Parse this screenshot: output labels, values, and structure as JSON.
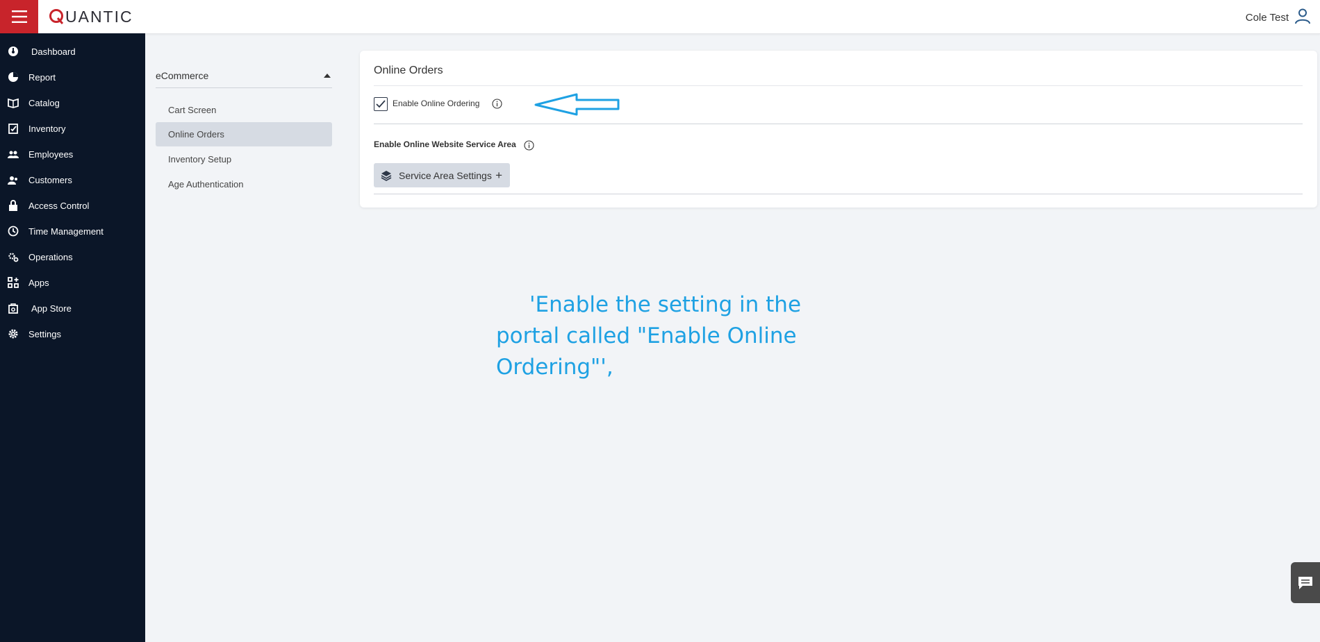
{
  "header": {
    "logo_text": "UANTIC",
    "user_name": "Cole Test"
  },
  "sidebar": {
    "items": [
      {
        "label": "Dashboard",
        "icon": "dashboard-icon"
      },
      {
        "label": "Report",
        "icon": "pie-chart-icon"
      },
      {
        "label": "Catalog",
        "icon": "book-icon"
      },
      {
        "label": "Inventory",
        "icon": "clipboard-check-icon"
      },
      {
        "label": "Employees",
        "icon": "people-icon"
      },
      {
        "label": "Customers",
        "icon": "customers-icon"
      },
      {
        "label": "Access Control",
        "icon": "lock-icon"
      },
      {
        "label": "Time Management",
        "icon": "clock-icon"
      },
      {
        "label": "Operations",
        "icon": "gears-icon"
      },
      {
        "label": "Apps",
        "icon": "apps-icon"
      },
      {
        "label": "App Store",
        "icon": "store-icon"
      },
      {
        "label": "Settings",
        "icon": "gear-icon"
      }
    ]
  },
  "submenu": {
    "title": "eCommerce",
    "items": [
      {
        "label": "Cart Screen",
        "active": false
      },
      {
        "label": "Online Orders",
        "active": true
      },
      {
        "label": "Inventory Setup",
        "active": false
      },
      {
        "label": "Age Authentication",
        "active": false
      }
    ]
  },
  "card": {
    "title": "Online Orders",
    "enable_online_ordering_label": "Enable Online Ordering",
    "enable_online_ordering_checked": true,
    "service_area_label": "Enable Online Website Service Area",
    "service_area_button": "Service Area Settings",
    "plus_symbol": "+"
  },
  "annotation": {
    "text": "'Enable the setting in the portal called \"Enable Online Ordering\"',",
    "color": "#1ea1e3"
  },
  "colors": {
    "brand_red": "#c8242b",
    "sidebar_bg": "#0b1628",
    "page_bg": "#f2f4f7",
    "active_item_bg": "#d6dbe3"
  }
}
